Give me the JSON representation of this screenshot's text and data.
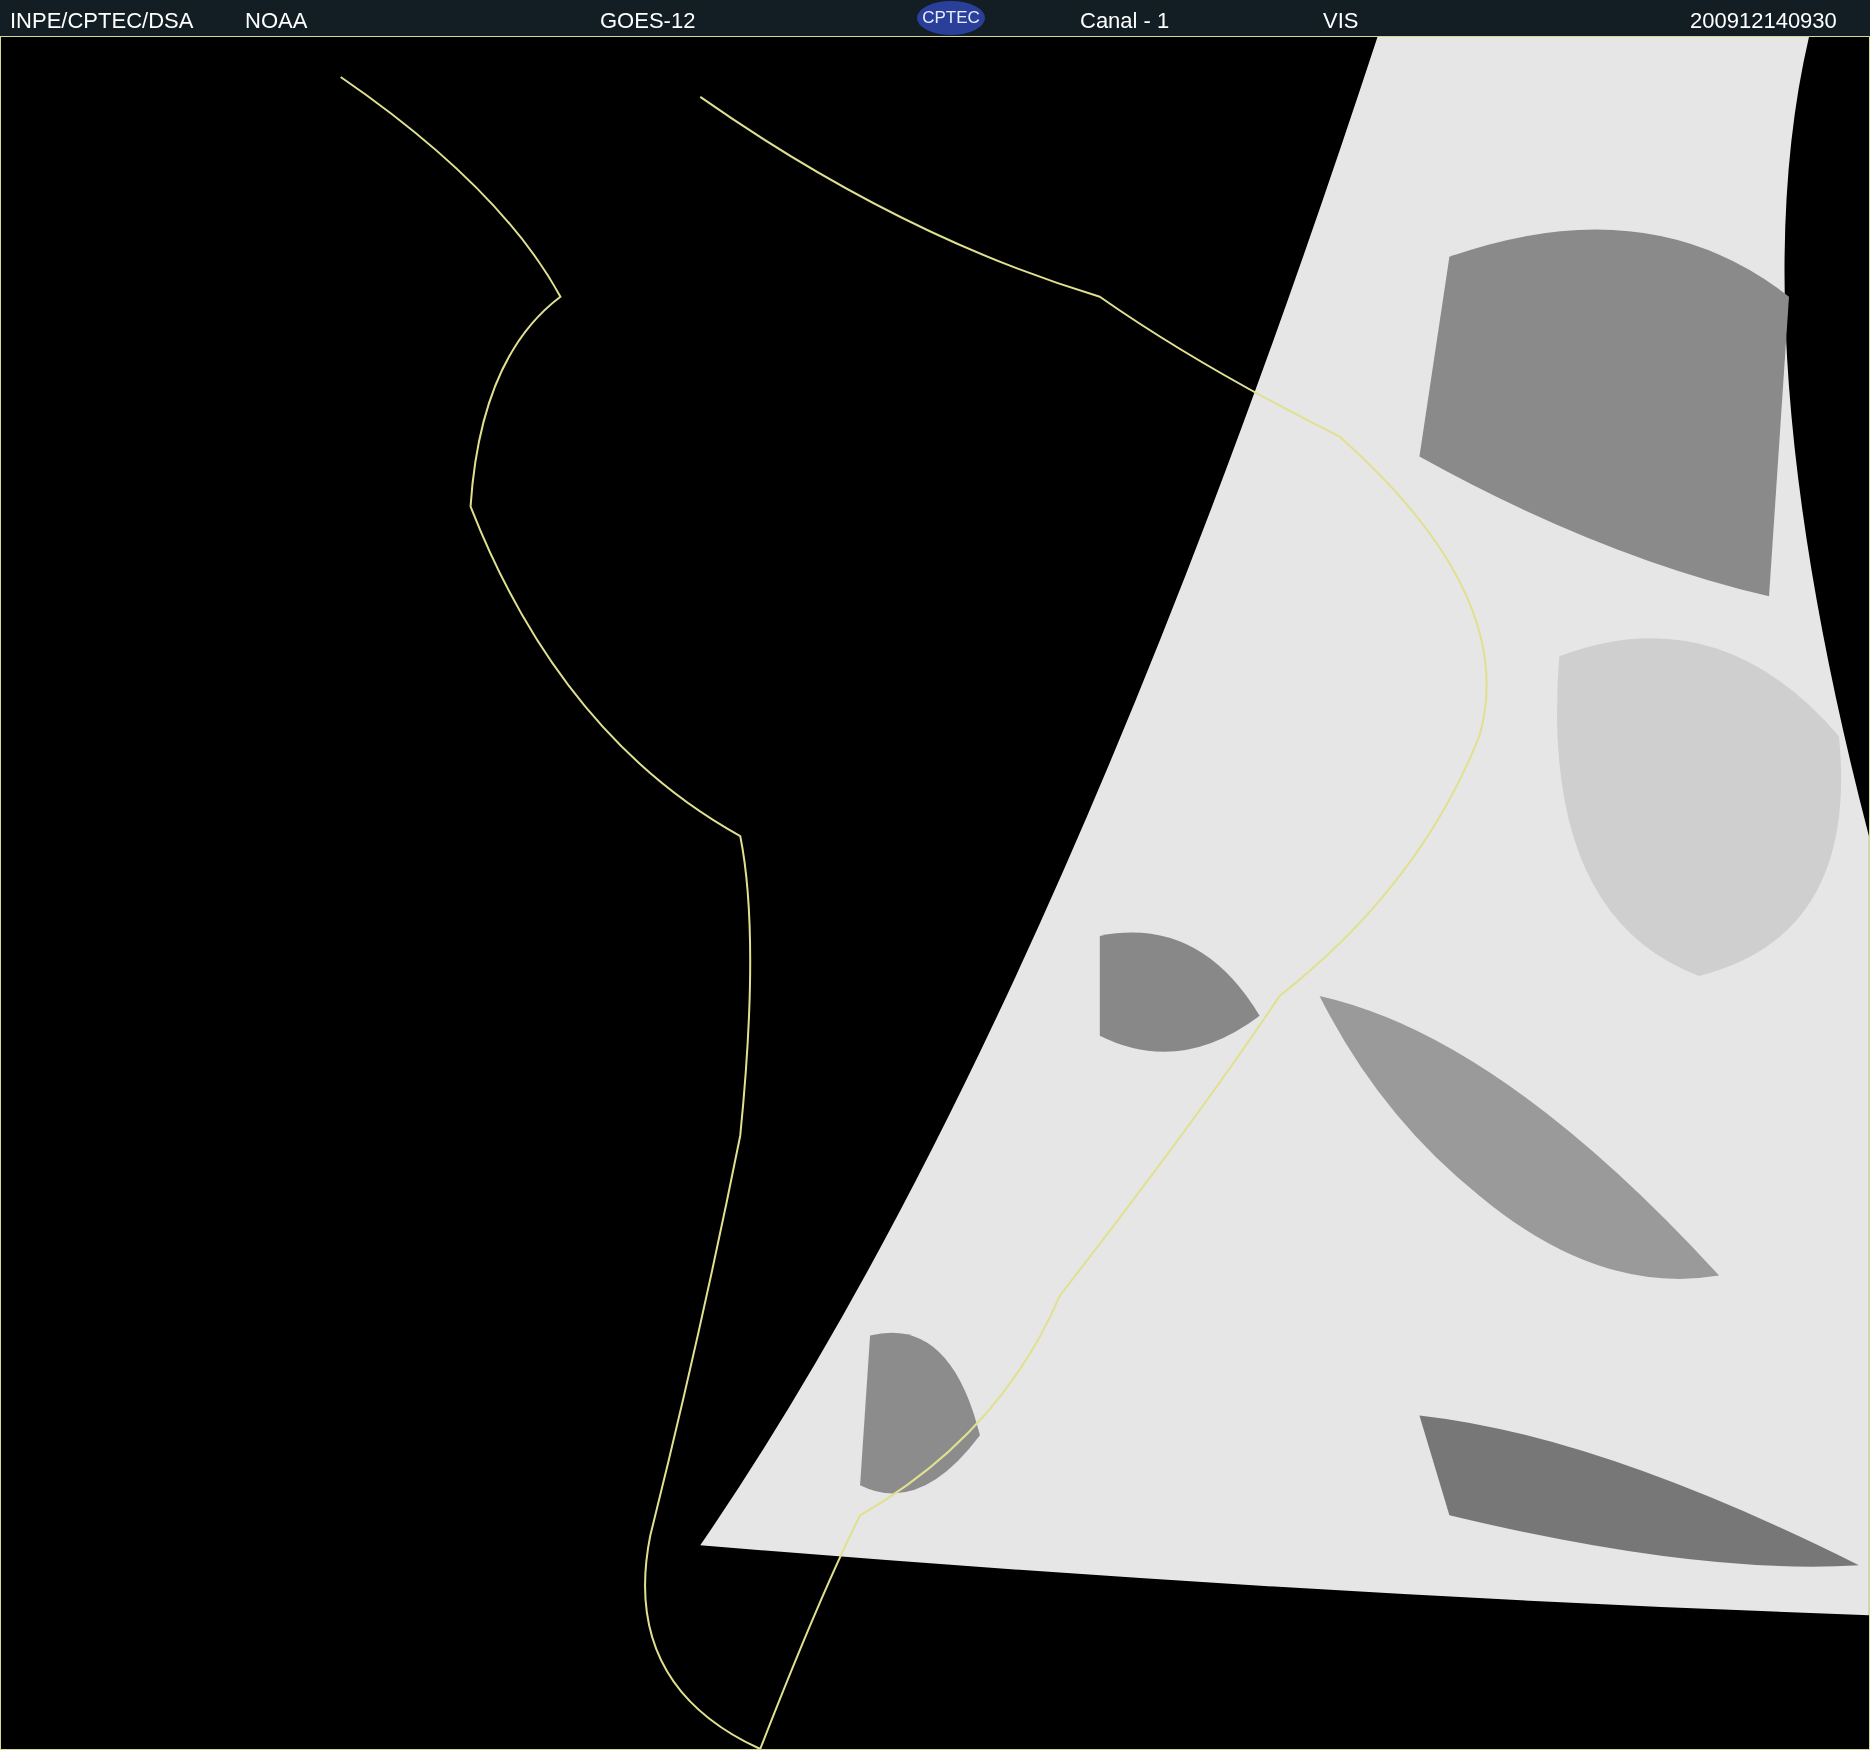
{
  "header": {
    "agency": "INPE/CPTEC/DSA",
    "source": "NOAA",
    "satellite": "GOES-12",
    "logo": "CPTEC",
    "channel": "Canal - 1",
    "band": "VIS",
    "timestamp": "200912140930"
  }
}
